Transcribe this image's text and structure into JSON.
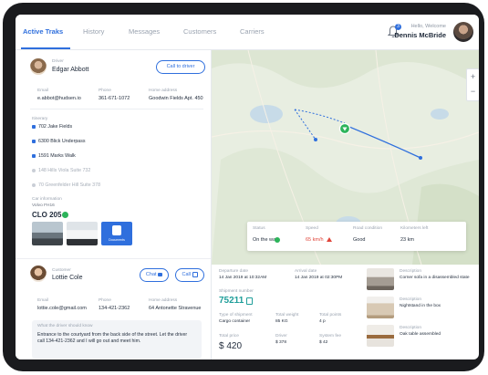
{
  "tabs": [
    "Active Traks",
    "History",
    "Messages",
    "Customers",
    "Carriers"
  ],
  "notifications_count": "3",
  "header": {
    "welcome": "Hello, Welcome",
    "user_name": "Dennis McBride"
  },
  "driver": {
    "role_label": "Driver",
    "name": "Edgar Abbott",
    "call_button": "Call to driver",
    "email_label": "Email",
    "email": "e.abbot@hudsen.io",
    "phone_label": "Phone",
    "phone": "361-671-1072",
    "home_label": "Home address",
    "home": "Goodwin Fields Apt. 450"
  },
  "itinerary": {
    "label": "Itinerary",
    "stops": [
      {
        "text": "702 Jake Fields",
        "done": true
      },
      {
        "text": "6300 Blick Underpass",
        "done": true
      },
      {
        "text": "1591 Marks Walk",
        "done": true
      },
      {
        "text": "148 Hills Viola Suite 732",
        "done": false
      },
      {
        "text": "70 Greenfelder Hill Suite 378",
        "done": false
      }
    ]
  },
  "car": {
    "label": "Car information",
    "model": "Volvo FH16",
    "plate": "CLO 205",
    "documents_label": "Documents"
  },
  "customer": {
    "role_label": "Customer",
    "name": "Lottie Cole",
    "chat_button": "Chat",
    "call_button": "Call",
    "email_label": "Email",
    "email": "lottie.cole@gmail.com",
    "phone_label": "Phone",
    "phone": "134-421-2362",
    "home_label": "Home address",
    "home": "64 Antonette Stravenue",
    "note_label": "What the driver should know",
    "note": "Entrance to the courtyard from the back side of the street. Let the driver call 134-421-2362 and I will go out and meet him."
  },
  "status_card": {
    "status_label": "Status",
    "status_value": "On the way",
    "speed_label": "Speed",
    "speed_value": "65 km/h",
    "road_label": "Road condition",
    "road_value": "Good",
    "km_label": "Kilometers left",
    "km_value": "23 km",
    "colors": {
      "on_way": "#2cb45a",
      "speed": "#e0453a"
    }
  },
  "shipment": {
    "departure_label": "Departure date",
    "departure": "14 Jan 2019 at 10:32AM",
    "arrival_label": "Arrival date",
    "arrival": "14 Jan 2019 at 02:30PM",
    "number_label": "Shipment number",
    "number": "75211",
    "type_label": "Type of shipment",
    "type": "Cargo container",
    "weight_label": "Total weight",
    "weight": "85 KG",
    "points_label": "Total points",
    "points": "4 p",
    "price_label": "Total price",
    "price": "$ 420",
    "driver_label": "Driver",
    "driver_val": "$ 378",
    "system_label": "System fee",
    "system_val": "$ 42"
  },
  "products": [
    {
      "label": "Description",
      "text": "Corner sofa in a disassembled state"
    },
    {
      "label": "Description",
      "text": "Nightstand in the box"
    },
    {
      "label": "Description",
      "text": "Oak table assembled"
    }
  ],
  "colors": {
    "accent": "#2f6fdd",
    "teal": "#1f9e9a"
  }
}
